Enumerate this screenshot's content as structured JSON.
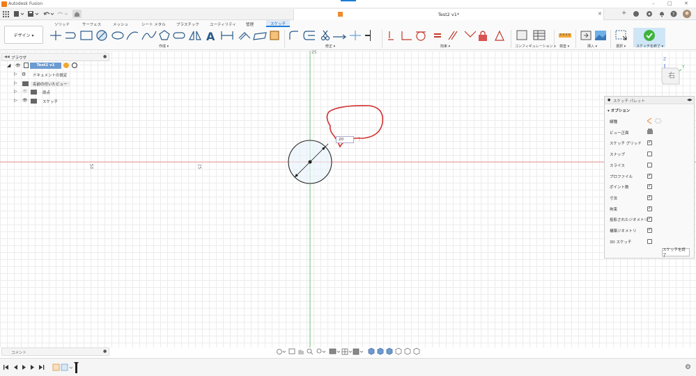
{
  "app": {
    "title": "Autodesk Fusion",
    "window_controls": [
      "–",
      "□",
      "✕"
    ]
  },
  "qab": {
    "items": [
      "grid-icon",
      "file-icon",
      "save-icon",
      "undo-icon",
      "redo-icon",
      "home-icon"
    ]
  },
  "doc": {
    "title": "Test2 v1*"
  },
  "tabs": [
    "ソリッド",
    "サーフェス",
    "メッシュ",
    "シート メタル",
    "プラスチック",
    "ユーティリティ",
    "管理",
    "スケッチ"
  ],
  "design_button": "デザイン ▾",
  "groups": {
    "create": "作成 ▾",
    "modify": "修正 ▾",
    "constraints": "拘束 ▾",
    "configure": "コンフィギュレーション ▾",
    "inspect": "検査 ▾",
    "insert": "挿入 ▾",
    "select": "選択 ▾",
    "finish": "スケッチを終了 ▾"
  },
  "browser": {
    "title": "ブラウザ",
    "items": [
      {
        "label": "Test2 v1"
      },
      {
        "label": "ドキュメントの設定"
      },
      {
        "label": "名前の付いたビュー"
      },
      {
        "label": "原点"
      },
      {
        "label": "スケッチ"
      }
    ]
  },
  "canvas": {
    "dimension_value": "20",
    "axis_labels": [
      "50",
      "25"
    ],
    "axis_top": "25"
  },
  "viewcube": {
    "face": "右",
    "axis_z": "Z",
    "axis_y": "Y"
  },
  "palette": {
    "title": "スケッチ パレット",
    "section": "オプション",
    "rows": [
      {
        "label": "線種",
        "kind": "icons"
      },
      {
        "label": "ビュー正面",
        "kind": "icon"
      },
      {
        "label": "スケッチ グリッド",
        "checked": true
      },
      {
        "label": "スナップ",
        "checked": false
      },
      {
        "label": "スライス",
        "checked": false
      },
      {
        "label": "プロファイル",
        "checked": true
      },
      {
        "label": "ポイント数",
        "checked": true
      },
      {
        "label": "寸法",
        "checked": true
      },
      {
        "label": "拘束",
        "checked": true
      },
      {
        "label": "投影されたジオメトリ",
        "checked": true
      },
      {
        "label": "構築ジオメトリ",
        "checked": true
      },
      {
        "label": "3D スケッチ",
        "checked": false
      }
    ],
    "finish_button": "スケッチを終了"
  },
  "comment": {
    "label": "コメント"
  },
  "colors": {
    "accent": "#1c7ed6",
    "finish": "#3fb43f",
    "x_axis": "#e57373",
    "y_axis": "#4caf50",
    "annotation": "#d32f2f"
  }
}
